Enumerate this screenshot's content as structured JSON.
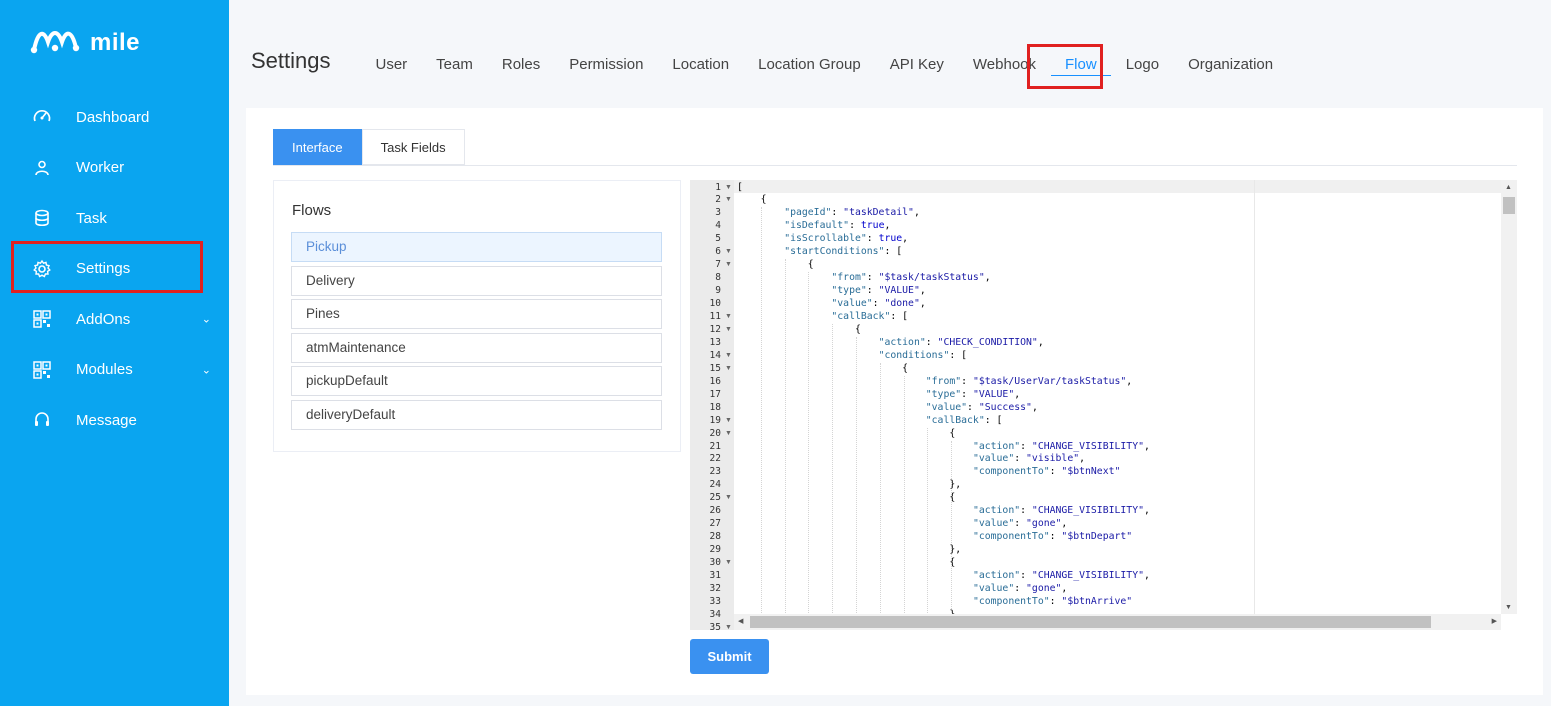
{
  "brand": {
    "name": "mile"
  },
  "sidebar": {
    "items": [
      {
        "label": "Dashboard",
        "icon": "speedometer-icon"
      },
      {
        "label": "Worker",
        "icon": "worker-icon"
      },
      {
        "label": "Task",
        "icon": "database-icon"
      },
      {
        "label": "Settings",
        "icon": "gear-icon",
        "active": true
      },
      {
        "label": "AddOns",
        "icon": "qr-grid-icon",
        "expandable": true
      },
      {
        "label": "Modules",
        "icon": "qr-grid-icon",
        "expandable": true
      },
      {
        "label": "Message",
        "icon": "headset-icon"
      }
    ]
  },
  "header": {
    "title": "Settings",
    "tabs": [
      "User",
      "Team",
      "Roles",
      "Permission",
      "Location",
      "Location Group",
      "API Key",
      "Webhook",
      "Flow",
      "Logo",
      "Organization"
    ],
    "active_tab": "Flow"
  },
  "subtabs": {
    "items": [
      "Interface",
      "Task Fields"
    ],
    "active": "Interface"
  },
  "flows": {
    "title": "Flows",
    "items": [
      "Pickup",
      "Delivery",
      "Pines",
      "atmMaintenance",
      "pickupDefault",
      "deliveryDefault"
    ],
    "active": "Pickup"
  },
  "editor": {
    "line_numbers": [
      "1",
      "2",
      "3",
      "4",
      "5",
      "6",
      "7",
      "8",
      "9",
      "10",
      "11",
      "12",
      "13",
      "14",
      "15",
      "16",
      "17",
      "18",
      "19",
      "20",
      "21",
      "22",
      "23",
      "24",
      "25",
      "26",
      "27",
      "28",
      "29",
      "30",
      "31",
      "32",
      "33",
      "34",
      "35"
    ],
    "folded_lines": [
      1,
      2,
      6,
      7,
      11,
      12,
      14,
      15,
      19,
      20,
      25,
      30,
      35
    ],
    "lines": [
      "[",
      "    {",
      "        \"pageId\": \"taskDetail\",",
      "        \"isDefault\": true,",
      "        \"isScrollable\": true,",
      "        \"startConditions\": [",
      "            {",
      "                \"from\": \"$task/taskStatus\",",
      "                \"type\": \"VALUE\",",
      "                \"value\": \"done\",",
      "                \"callBack\": [",
      "                    {",
      "                        \"action\": \"CHECK_CONDITION\",",
      "                        \"conditions\": [",
      "                            {",
      "                                \"from\": \"$task/UserVar/taskStatus\",",
      "                                \"type\": \"VALUE\",",
      "                                \"value\": \"Success\",",
      "                                \"callBack\": [",
      "                                    {",
      "                                        \"action\": \"CHANGE_VISIBILITY\",",
      "                                        \"value\": \"visible\",",
      "                                        \"componentTo\": \"$btnNext\"",
      "                                    },",
      "                                    {",
      "                                        \"action\": \"CHANGE_VISIBILITY\",",
      "                                        \"value\": \"gone\",",
      "                                        \"componentTo\": \"$btnDepart\"",
      "                                    },",
      "                                    {",
      "                                        \"action\": \"CHANGE_VISIBILITY\",",
      "                                        \"value\": \"gone\",",
      "                                        \"componentTo\": \"$btnArrive\"",
      "                                    },",
      "                                    {"
    ]
  },
  "actions": {
    "submit_label": "Submit"
  },
  "colors": {
    "sidebar": "#0aa5f0",
    "accent": "#3a91f0",
    "highlight": "#e02020",
    "link_active": "#1890ff"
  }
}
